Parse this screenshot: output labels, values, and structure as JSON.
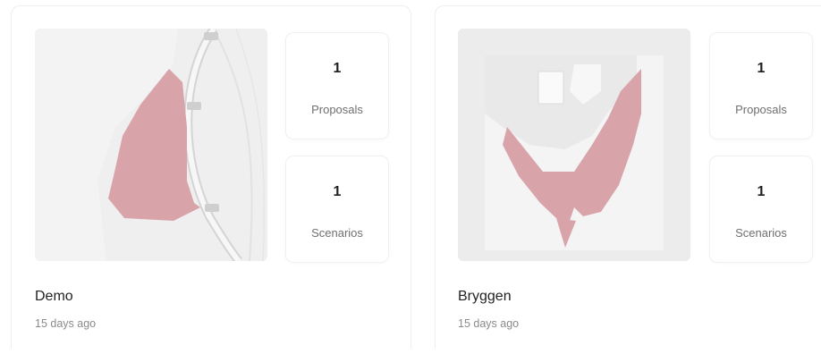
{
  "projects": [
    {
      "name": "Demo",
      "updated": "15 days ago",
      "proposals": {
        "count": "1",
        "label": "Proposals"
      },
      "scenarios": {
        "count": "1",
        "label": "Scenarios"
      }
    },
    {
      "name": "Bryggen",
      "updated": "15 days ago",
      "proposals": {
        "count": "1",
        "label": "Proposals"
      },
      "scenarios": {
        "count": "1",
        "label": "Scenarios"
      }
    }
  ],
  "colors": {
    "area_fill": "#d9a3aa",
    "map_bg": "#ececec",
    "card_border": "#eeeeee"
  }
}
